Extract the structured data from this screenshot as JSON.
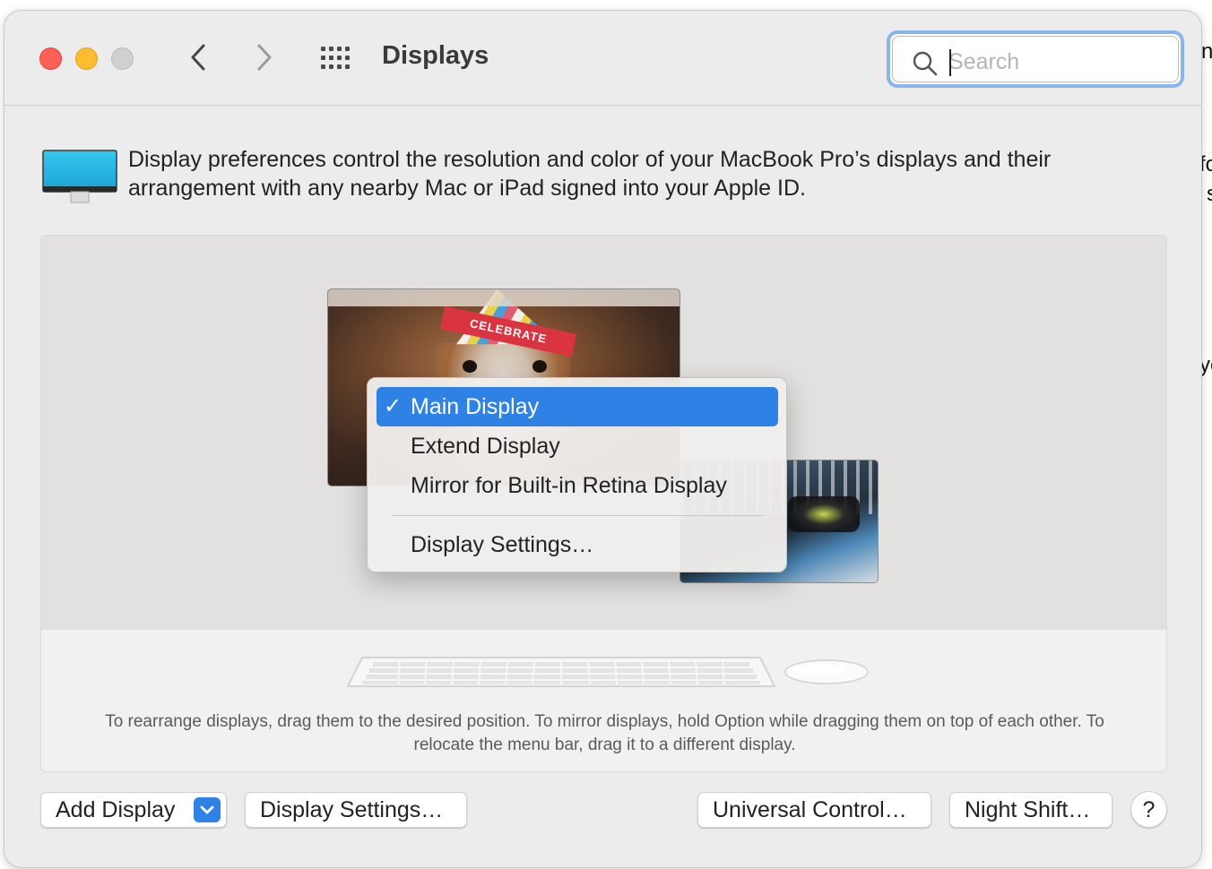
{
  "window": {
    "title": "Displays",
    "search_placeholder": "Search"
  },
  "intro": {
    "description": "Display preferences control the resolution and color of your MacBook Pro’s displays and their arrangement with any nearby Mac or iPad signed into your Apple ID."
  },
  "arrangement": {
    "wallpaper_text": "CELEBRATE",
    "popup_menu": {
      "check_mark": "✓",
      "items": [
        {
          "label": "Main Display",
          "selected": true
        },
        {
          "label": "Extend Display",
          "selected": false
        },
        {
          "label": "Mirror for Built-in Retina Display",
          "selected": false
        },
        {
          "label": "Display Settings…",
          "selected": false
        }
      ]
    },
    "hint": "To rearrange displays, drag them to the desired position. To mirror displays, hold Option while dragging them on top of each other. To relocate the menu bar, drag it to a different display."
  },
  "footer": {
    "add_display": "Add Display",
    "display_settings": "Display Settings…",
    "universal_control": "Universal Control…",
    "night_shift": "Night Shift…",
    "help": "?"
  },
  "background_edge": {
    "chars": [
      "n",
      "fo",
      "s",
      "yo"
    ]
  },
  "colors": {
    "accent": "#2f82e5",
    "close": "#fe5f57",
    "minimize": "#febc2e",
    "search_focus_ring": "#8ab5ec"
  }
}
